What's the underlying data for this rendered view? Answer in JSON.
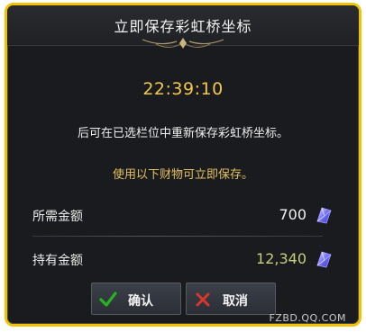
{
  "dialog": {
    "title": "立即保存彩虹桥坐标",
    "timer": "22:39:10",
    "description": "后可在已选栏位中重新保存彩虹桥坐标。",
    "hint": "使用以下财物可立即保存。"
  },
  "rows": [
    {
      "label": "所需金额",
      "value": "700",
      "value_color": "#f2f2f2",
      "icon": "crystal-currency-icon"
    },
    {
      "label": "持有金额",
      "value": "12,340",
      "value_color": "#c8cf7a",
      "icon": "crystal-currency-icon"
    }
  ],
  "buttons": {
    "confirm_label": "确认",
    "cancel_label": "取消"
  },
  "watermark": "FZBD.QQ.COM",
  "colors": {
    "frame": "#f2c200",
    "timer": "#f3c94a",
    "hint": "#e3c063",
    "confirm_icon": "#27b31f",
    "cancel_icon": "#d8382c"
  }
}
